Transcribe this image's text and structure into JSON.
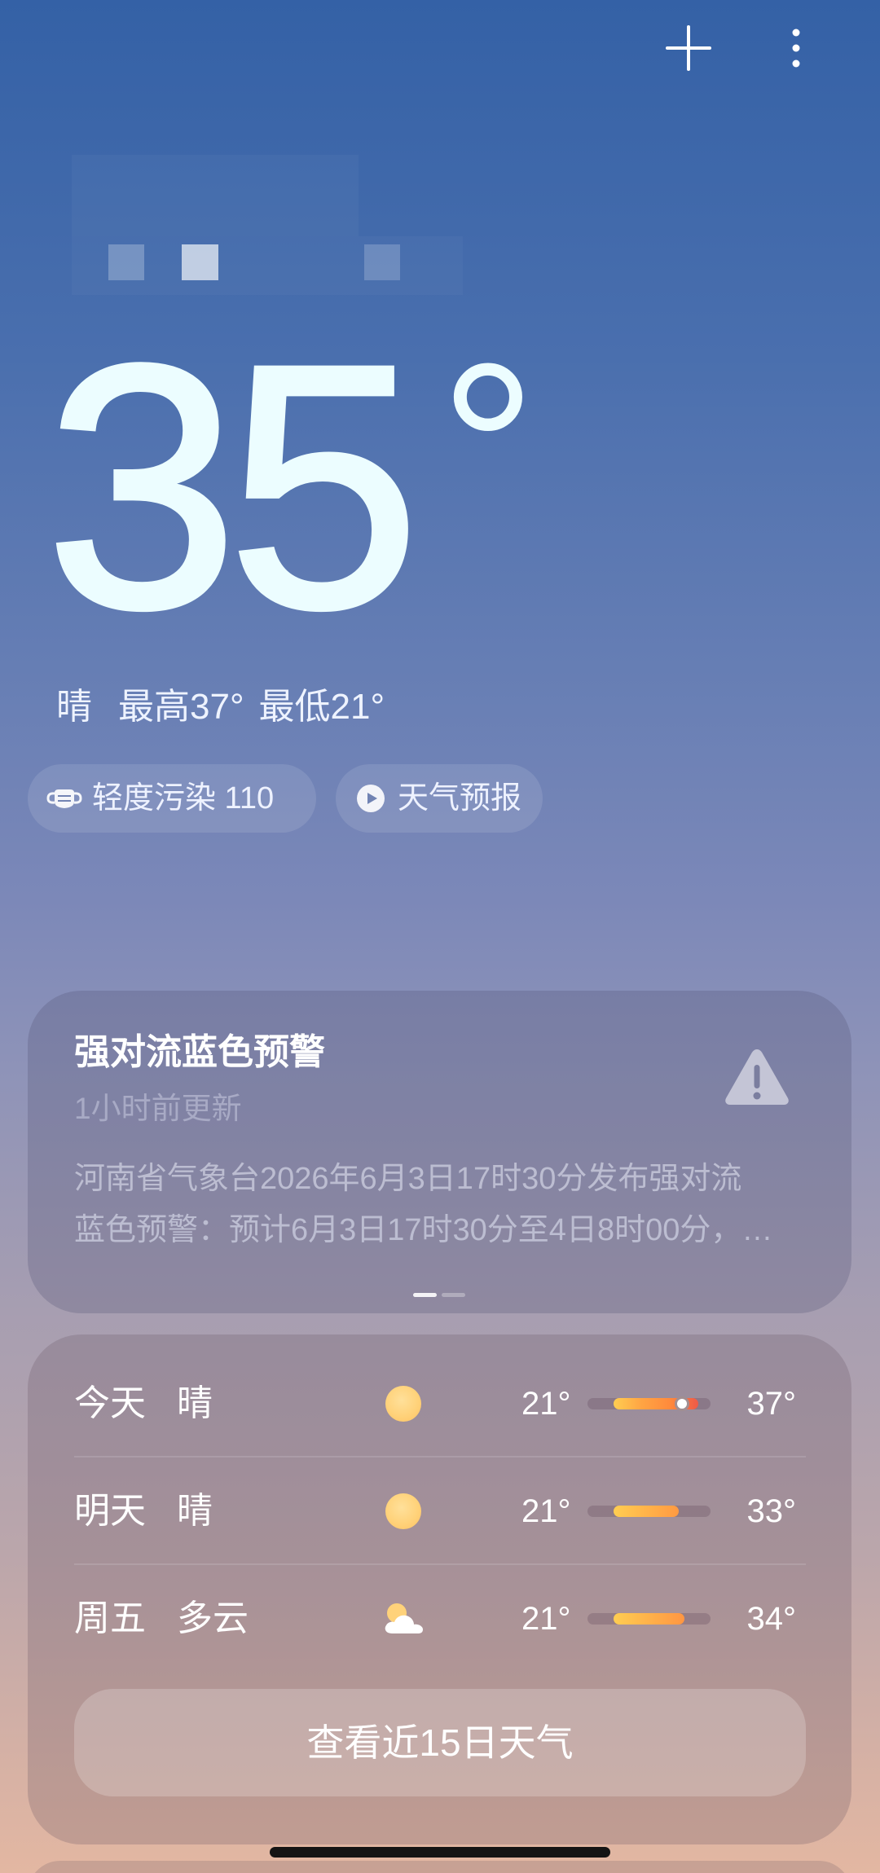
{
  "toolbar": {
    "add_icon": "plus-icon",
    "more_icon": "more-vertical-icon"
  },
  "current": {
    "temperature": "35",
    "degree": "°",
    "condition": "晴",
    "high": "最高37°",
    "low": "最低21°"
  },
  "chips": {
    "air_quality": {
      "icon": "mask-icon",
      "label": "轻度污染 110"
    },
    "forecast_video": {
      "icon": "play-circle-icon",
      "label": "天气预报"
    }
  },
  "alert": {
    "icon": "warning-icon",
    "title": "强对流蓝色预警",
    "updated": "1小时前更新",
    "lines": [
      "河南省气象台2026年6月3日17时30分发布强对流",
      "蓝色预警：预计6月3日17时30分至4日8时00分，…"
    ],
    "page": 1,
    "page_count": 2
  },
  "forecast": {
    "days": [
      {
        "day": "今天",
        "condition": "晴",
        "icon": "sun-icon",
        "low": "21°",
        "high": "37°",
        "temp_bar": {
          "from": 0.21,
          "to": 0.9,
          "now": 0.77
        },
        "bar_colors": [
          "#ffcd52",
          "#ffa443",
          "#ff8a3c",
          "#ee5a48"
        ]
      },
      {
        "day": "明天",
        "condition": "晴",
        "icon": "sun-icon",
        "low": "21°",
        "high": "33°",
        "temp_bar": {
          "from": 0.21,
          "to": 0.74
        },
        "bar_colors": [
          "#ffcd52",
          "#ff9a42"
        ]
      },
      {
        "day": "周五",
        "condition": "多云",
        "icon": "partly-cloudy-icon",
        "low": "21°",
        "high": "34°",
        "temp_bar": {
          "from": 0.21,
          "to": 0.79
        },
        "bar_colors": [
          "#ffcd52",
          "#ff9642"
        ]
      }
    ],
    "more_button": "查看近15日天气"
  }
}
